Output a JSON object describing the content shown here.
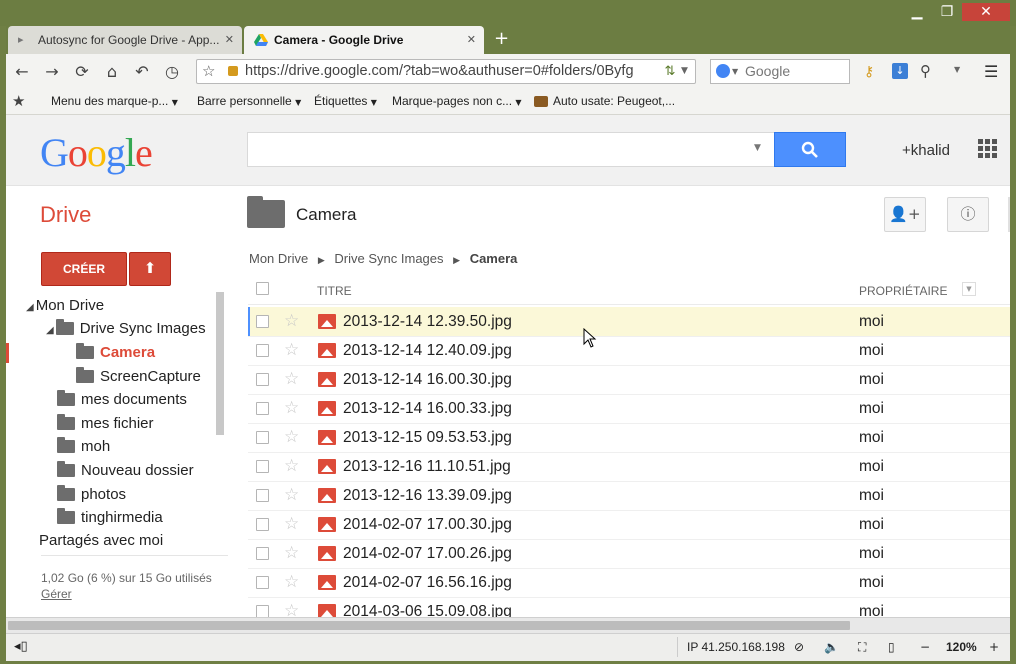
{
  "window": {
    "minimize": "▁",
    "maximize": "❐",
    "close": "✕"
  },
  "tabs": [
    {
      "label": "Autosync for Google Drive - App...",
      "close": "✕"
    },
    {
      "label": "Camera - Google Drive",
      "close": "✕"
    }
  ],
  "new_tab": "+",
  "toolbar": {
    "back": "←",
    "forward": "→",
    "reload": "⟳",
    "home": "⌂",
    "undo": "↶",
    "history": "◷",
    "url": "https://drive.google.com/?tab=wo&authuser=0#folders/0Byfg",
    "search_placeholder": "Google",
    "menu": "☰"
  },
  "bookmarks": [
    {
      "label": "Menu des marque-p..."
    },
    {
      "label": "Barre personnelle"
    },
    {
      "label": "Étiquettes"
    },
    {
      "label": "Marque-pages non c..."
    },
    {
      "label": "Auto usate: Peugeot,..."
    }
  ],
  "google": {
    "search_value": "",
    "user": "+khalid"
  },
  "drive": {
    "label": "Drive",
    "folder_title": "Camera",
    "create_label": "CRÉER",
    "breadcrumb": [
      "Mon Drive",
      "Drive Sync Images",
      "Camera"
    ]
  },
  "tree": [
    {
      "label": "Mon Drive"
    },
    {
      "label": "Drive Sync Images"
    },
    {
      "label": "Camera"
    },
    {
      "label": "ScreenCapture"
    },
    {
      "label": "mes documents"
    },
    {
      "label": "mes fichier"
    },
    {
      "label": "moh"
    },
    {
      "label": "Nouveau dossier"
    },
    {
      "label": "photos"
    },
    {
      "label": "tinghirmedia"
    },
    {
      "label": "Partagés avec moi"
    }
  ],
  "storage": {
    "usage": "1,02 Go (6 %) sur 15 Go utilisés",
    "manage": "Gérer"
  },
  "list": {
    "col_title": "TITRE",
    "col_owner": "PROPRIÉTAIRE",
    "rows": [
      {
        "name": "2013-12-14 12.39.50.jpg",
        "owner": "moi"
      },
      {
        "name": "2013-12-14 12.40.09.jpg",
        "owner": "moi"
      },
      {
        "name": "2013-12-14 16.00.30.jpg",
        "owner": "moi"
      },
      {
        "name": "2013-12-14 16.00.33.jpg",
        "owner": "moi"
      },
      {
        "name": "2013-12-15 09.53.53.jpg",
        "owner": "moi"
      },
      {
        "name": "2013-12-16 11.10.51.jpg",
        "owner": "moi"
      },
      {
        "name": "2013-12-16 13.39.09.jpg",
        "owner": "moi"
      },
      {
        "name": "2014-02-07 17.00.30.jpg",
        "owner": "moi"
      },
      {
        "name": "2014-02-07 17.00.26.jpg",
        "owner": "moi"
      },
      {
        "name": "2014-02-07 16.56.16.jpg",
        "owner": "moi"
      },
      {
        "name": "2014-03-06 15.09.08.jpg",
        "owner": "moi"
      }
    ]
  },
  "statusbar": {
    "ip": "IP 41.250.168.198",
    "zoom": "120%",
    "minus": "−",
    "plus": "+"
  },
  "colors": {
    "drive_red": "#dd4b39",
    "search_blue": "#4d90fe",
    "selected_row": "#fbf8d8"
  }
}
